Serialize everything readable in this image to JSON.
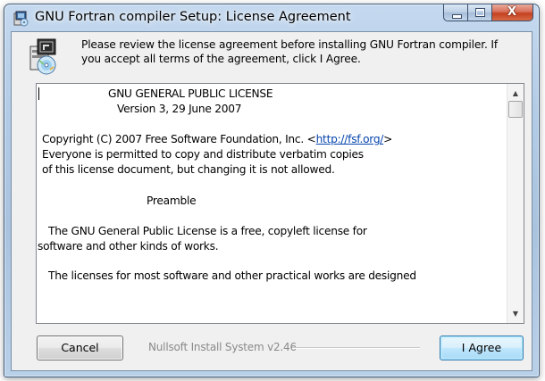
{
  "window": {
    "title": "GNU Fortran compiler Setup: License Agreement",
    "close_glyph": "X"
  },
  "header": {
    "instruction": "Please review the license agreement before installing GNU Fortran compiler. If you accept all terms of the agreement, click I Agree."
  },
  "license": {
    "lines": [
      {
        "text": "GNU GENERAL PUBLIC LICENSE"
      },
      {
        "text": "Version 3, 29 June 2007"
      },
      {
        "text": "Copyright (C) 2007 Free Software Foundation, Inc. <",
        "link": "http://fsf.org/",
        "after": ">"
      },
      {
        "text": "Everyone is permitted to copy and distribute verbatim copies"
      },
      {
        "text": "of this license document, but changing it is not allowed."
      },
      {
        "text": "Preamble"
      },
      {
        "text": "The GNU General Public License is a free, copyleft license for"
      },
      {
        "text": "software and other kinds of works."
      },
      {
        "text": "The licenses for most software and other practical works are designed"
      }
    ]
  },
  "footer": {
    "cancel_label": "Cancel",
    "branding": "Nullsoft Install System v2.46",
    "agree_label": "I Agree"
  },
  "scrollbar": {
    "up_glyph": "▲",
    "down_glyph": "▼"
  }
}
